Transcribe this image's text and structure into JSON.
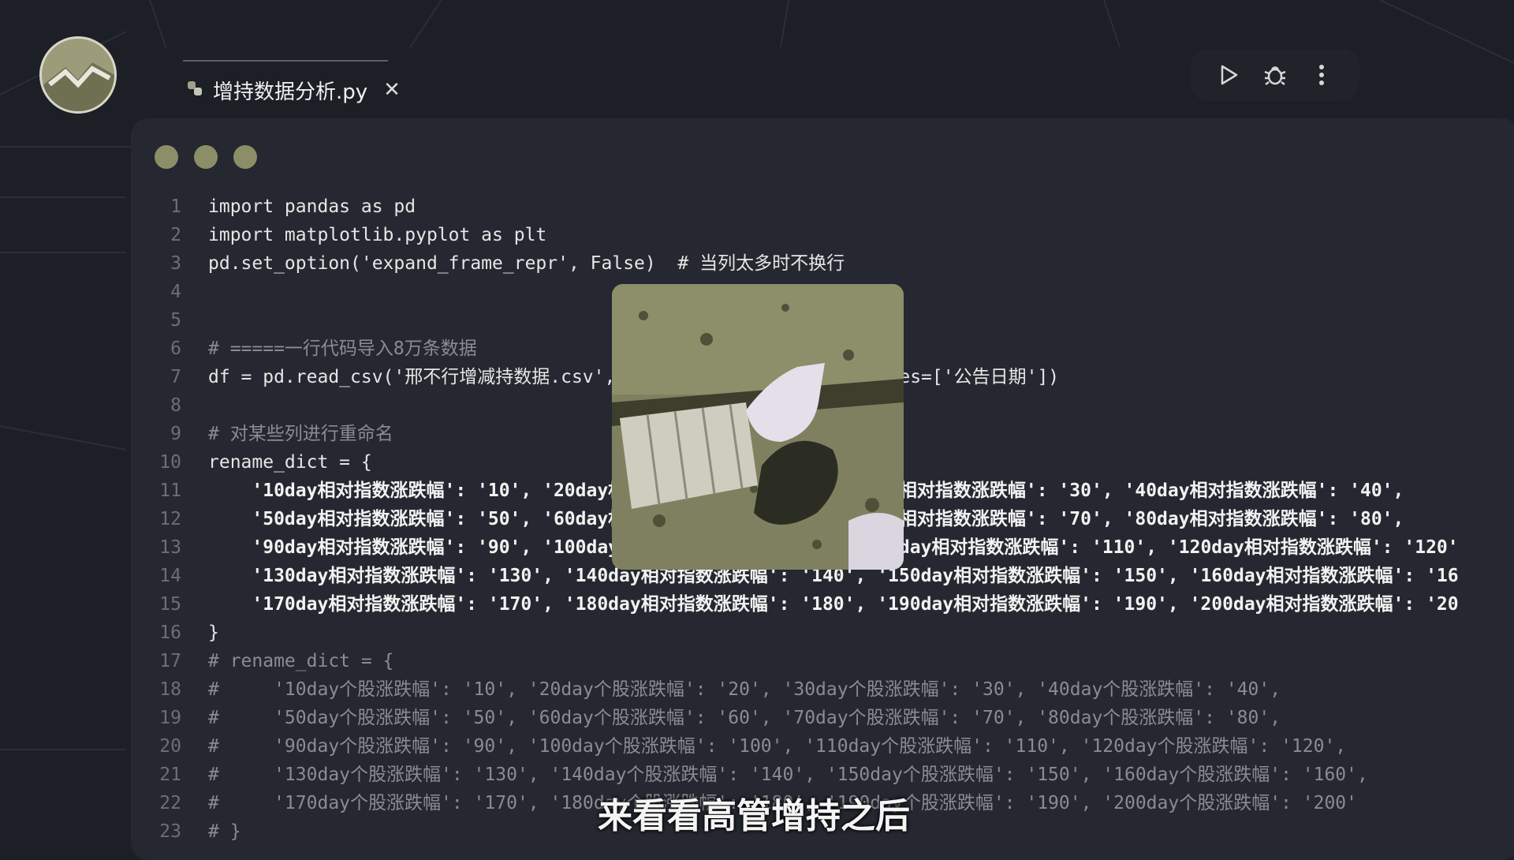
{
  "tab": {
    "filename": "增持数据分析.py",
    "close_glyph": "✕"
  },
  "toolbar": {
    "run_glyph": "▷",
    "more_glyph": "⋮"
  },
  "code_lines": [
    {
      "n": "1",
      "t": "import pandas as pd",
      "s": "normal"
    },
    {
      "n": "2",
      "t": "import matplotlib.pyplot as plt",
      "s": "normal"
    },
    {
      "n": "3",
      "t": "pd.set_option('expand_frame_repr', False)  # 当列太多时不换行",
      "s": "normal"
    },
    {
      "n": "4",
      "t": "",
      "s": "normal"
    },
    {
      "n": "5",
      "t": "",
      "s": "normal"
    },
    {
      "n": "6",
      "t": "# =====一行代码导入8万条数据",
      "s": "comment"
    },
    {
      "n": "7",
      "t": "df = pd.read_csv('邢不行增减持数据.csv', encoding='gbk', parse_dates=['公告日期'])",
      "s": "normal"
    },
    {
      "n": "8",
      "t": "",
      "s": "normal"
    },
    {
      "n": "9",
      "t": "# 对某些列进行重命名",
      "s": "comment"
    },
    {
      "n": "10",
      "t": "rename_dict = {",
      "s": "normal"
    },
    {
      "n": "11",
      "t": "    '10day相对指数涨跌幅': '10', '20day相对指数涨跌幅': '20', '30day相对指数涨跌幅': '30', '40day相对指数涨跌幅': '40',",
      "s": "bold"
    },
    {
      "n": "12",
      "t": "    '50day相对指数涨跌幅': '50', '60day相对指数涨跌幅': '60', '70day相对指数涨跌幅': '70', '80day相对指数涨跌幅': '80',",
      "s": "bold"
    },
    {
      "n": "13",
      "t": "    '90day相对指数涨跌幅': '90', '100day相对指数涨跌幅': '100', '110day相对指数涨跌幅': '110', '120day相对指数涨跌幅': '120'",
      "s": "bold"
    },
    {
      "n": "14",
      "t": "    '130day相对指数涨跌幅': '130', '140day相对指数涨跌幅': '140', '150day相对指数涨跌幅': '150', '160day相对指数涨跌幅': '16",
      "s": "bold"
    },
    {
      "n": "15",
      "t": "    '170day相对指数涨跌幅': '170', '180day相对指数涨跌幅': '180', '190day相对指数涨跌幅': '190', '200day相对指数涨跌幅': '20",
      "s": "bold"
    },
    {
      "n": "16",
      "t": "}",
      "s": "normal"
    },
    {
      "n": "17",
      "t": "# rename_dict = {",
      "s": "comment"
    },
    {
      "n": "18",
      "t": "#     '10day个股涨跌幅': '10', '20day个股涨跌幅': '20', '30day个股涨跌幅': '30', '40day个股涨跌幅': '40',",
      "s": "comment"
    },
    {
      "n": "19",
      "t": "#     '50day个股涨跌幅': '50', '60day个股涨跌幅': '60', '70day个股涨跌幅': '70', '80day个股涨跌幅': '80',",
      "s": "comment"
    },
    {
      "n": "20",
      "t": "#     '90day个股涨跌幅': '90', '100day个股涨跌幅': '100', '110day个股涨跌幅': '110', '120day个股涨跌幅': '120',",
      "s": "comment"
    },
    {
      "n": "21",
      "t": "#     '130day个股涨跌幅': '130', '140day个股涨跌幅': '140', '150day个股涨跌幅': '150', '160day个股涨跌幅': '160',",
      "s": "comment"
    },
    {
      "n": "22",
      "t": "#     '170day个股涨跌幅': '170', '180day个股涨跌幅': '180', '190day个股涨跌幅': '190', '200day个股涨跌幅': '200'",
      "s": "comment"
    },
    {
      "n": "23",
      "t": "# }",
      "s": "comment"
    }
  ],
  "subtitle": "来看看高管增持之后",
  "colors": {
    "background": "#1c1f26",
    "editor": "#252830",
    "traffic_light": "#8c8e68",
    "comment": "#8a8c92",
    "photo_tint": "#7f8060"
  },
  "icons": [
    "python-file-icon",
    "close-icon",
    "run-icon",
    "debug-icon",
    "more-icon"
  ]
}
